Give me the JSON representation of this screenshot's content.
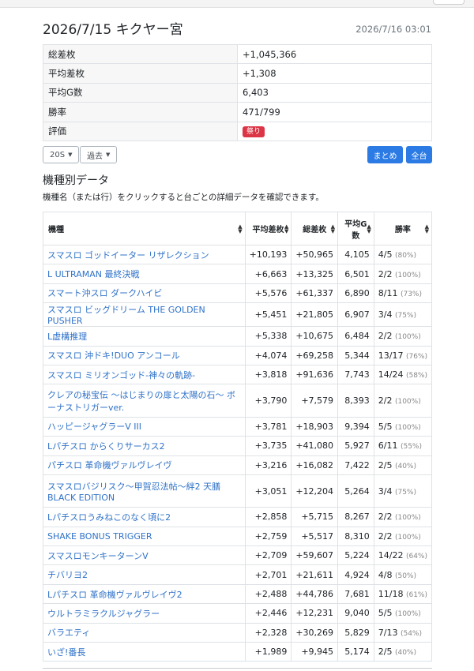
{
  "header": {
    "title": "2026/7/15 キクヤー宮",
    "updated": "2026/7/16 03:01"
  },
  "summary": [
    {
      "key": "総差枚",
      "value": "+1,045,366"
    },
    {
      "key": "平均差枚",
      "value": "+1,308"
    },
    {
      "key": "平均G数",
      "value": "6,403"
    },
    {
      "key": "勝率",
      "value": "471/799"
    },
    {
      "key": "評価",
      "value": "祭り",
      "badge_color": "#dc3545"
    }
  ],
  "controls": {
    "count_select": "20S",
    "period_select": "過去",
    "summary_button": "まとめ",
    "all_button": "全台"
  },
  "section": {
    "title": "機種別データ",
    "description": "機種名（または行）をクリックすると台ごとの詳細データを確認できます。"
  },
  "table": {
    "headers": {
      "name": "機種",
      "avg_diff": "平均差枚",
      "total_diff": "総差枚",
      "avg_games": "平均G数",
      "win_rate": "勝率"
    },
    "rows": [
      {
        "name": "スマスロ ゴッドイーター リザレクション",
        "avg": "+10,193",
        "total": "+50,965",
        "games": "4,105",
        "win": "4/5",
        "pct": "(80%)"
      },
      {
        "name": "L ULTRAMAN 最終決戦",
        "avg": "+6,663",
        "total": "+13,325",
        "games": "6,501",
        "win": "2/2",
        "pct": "(100%)"
      },
      {
        "name": "スマート沖スロ ダークハイビ",
        "avg": "+5,576",
        "total": "+61,337",
        "games": "6,890",
        "win": "8/11",
        "pct": "(73%)"
      },
      {
        "name": "スマスロ ビッグドリーム THE GOLDEN PUSHER",
        "avg": "+5,451",
        "total": "+21,805",
        "games": "6,907",
        "win": "3/4",
        "pct": "(75%)"
      },
      {
        "name": "L虚構推理",
        "avg": "+5,338",
        "total": "+10,675",
        "games": "6,484",
        "win": "2/2",
        "pct": "(100%)"
      },
      {
        "name": "スマスロ 沖ドキ!DUO アンコール",
        "avg": "+4,074",
        "total": "+69,258",
        "games": "5,344",
        "win": "13/17",
        "pct": "(76%)"
      },
      {
        "name": "スマスロ ミリオンゴッド-神々の軌跡-",
        "avg": "+3,818",
        "total": "+91,636",
        "games": "7,743",
        "win": "14/24",
        "pct": "(58%)"
      },
      {
        "name": "クレアの秘宝伝 〜はじまりの扉と太陽の石〜 ボーナストリガーver.",
        "avg": "+3,790",
        "total": "+7,579",
        "games": "8,393",
        "win": "2/2",
        "pct": "(100%)",
        "tall": true
      },
      {
        "name": "ハッピージャグラーV III",
        "avg": "+3,781",
        "total": "+18,903",
        "games": "9,394",
        "win": "5/5",
        "pct": "(100%)"
      },
      {
        "name": "Lパチスロ からくりサーカス2",
        "avg": "+3,735",
        "total": "+41,080",
        "games": "5,927",
        "win": "6/11",
        "pct": "(55%)"
      },
      {
        "name": "パチスロ 革命機ヴァルヴレイヴ",
        "avg": "+3,216",
        "total": "+16,082",
        "games": "7,422",
        "win": "2/5",
        "pct": "(40%)"
      },
      {
        "name": "スマスロバジリスク〜甲賀忍法帖〜絆2 天膳 BLACK EDITION",
        "avg": "+3,051",
        "total": "+12,204",
        "games": "5,264",
        "win": "3/4",
        "pct": "(75%)",
        "tall": true
      },
      {
        "name": "Lパチスロうみねこのなく頃に2",
        "avg": "+2,858",
        "total": "+5,715",
        "games": "8,267",
        "win": "2/2",
        "pct": "(100%)"
      },
      {
        "name": "SHAKE BONUS TRIGGER",
        "avg": "+2,759",
        "total": "+5,517",
        "games": "8,310",
        "win": "2/2",
        "pct": "(100%)"
      },
      {
        "name": "スマスロモンキーターンV",
        "avg": "+2,709",
        "total": "+59,607",
        "games": "5,224",
        "win": "14/22",
        "pct": "(64%)"
      },
      {
        "name": "チバリヨ2",
        "avg": "+2,701",
        "total": "+21,611",
        "games": "4,924",
        "win": "4/8",
        "pct": "(50%)"
      },
      {
        "name": "Lパチスロ 革命機ヴァルヴレイヴ2",
        "avg": "+2,488",
        "total": "+44,786",
        "games": "7,681",
        "win": "11/18",
        "pct": "(61%)"
      },
      {
        "name": "ウルトラミラクルジャグラー",
        "avg": "+2,446",
        "total": "+12,231",
        "games": "9,040",
        "win": "5/5",
        "pct": "(100%)"
      },
      {
        "name": "バラエティ",
        "avg": "+2,328",
        "total": "+30,269",
        "games": "5,829",
        "win": "7/13",
        "pct": "(54%)"
      },
      {
        "name": "いざ!番長",
        "avg": "+1,989",
        "total": "+9,945",
        "games": "5,174",
        "win": "2/5",
        "pct": "(40%)"
      }
    ]
  },
  "icons": {
    "sort": "sort-icon",
    "caret": "caret-down-icon"
  }
}
